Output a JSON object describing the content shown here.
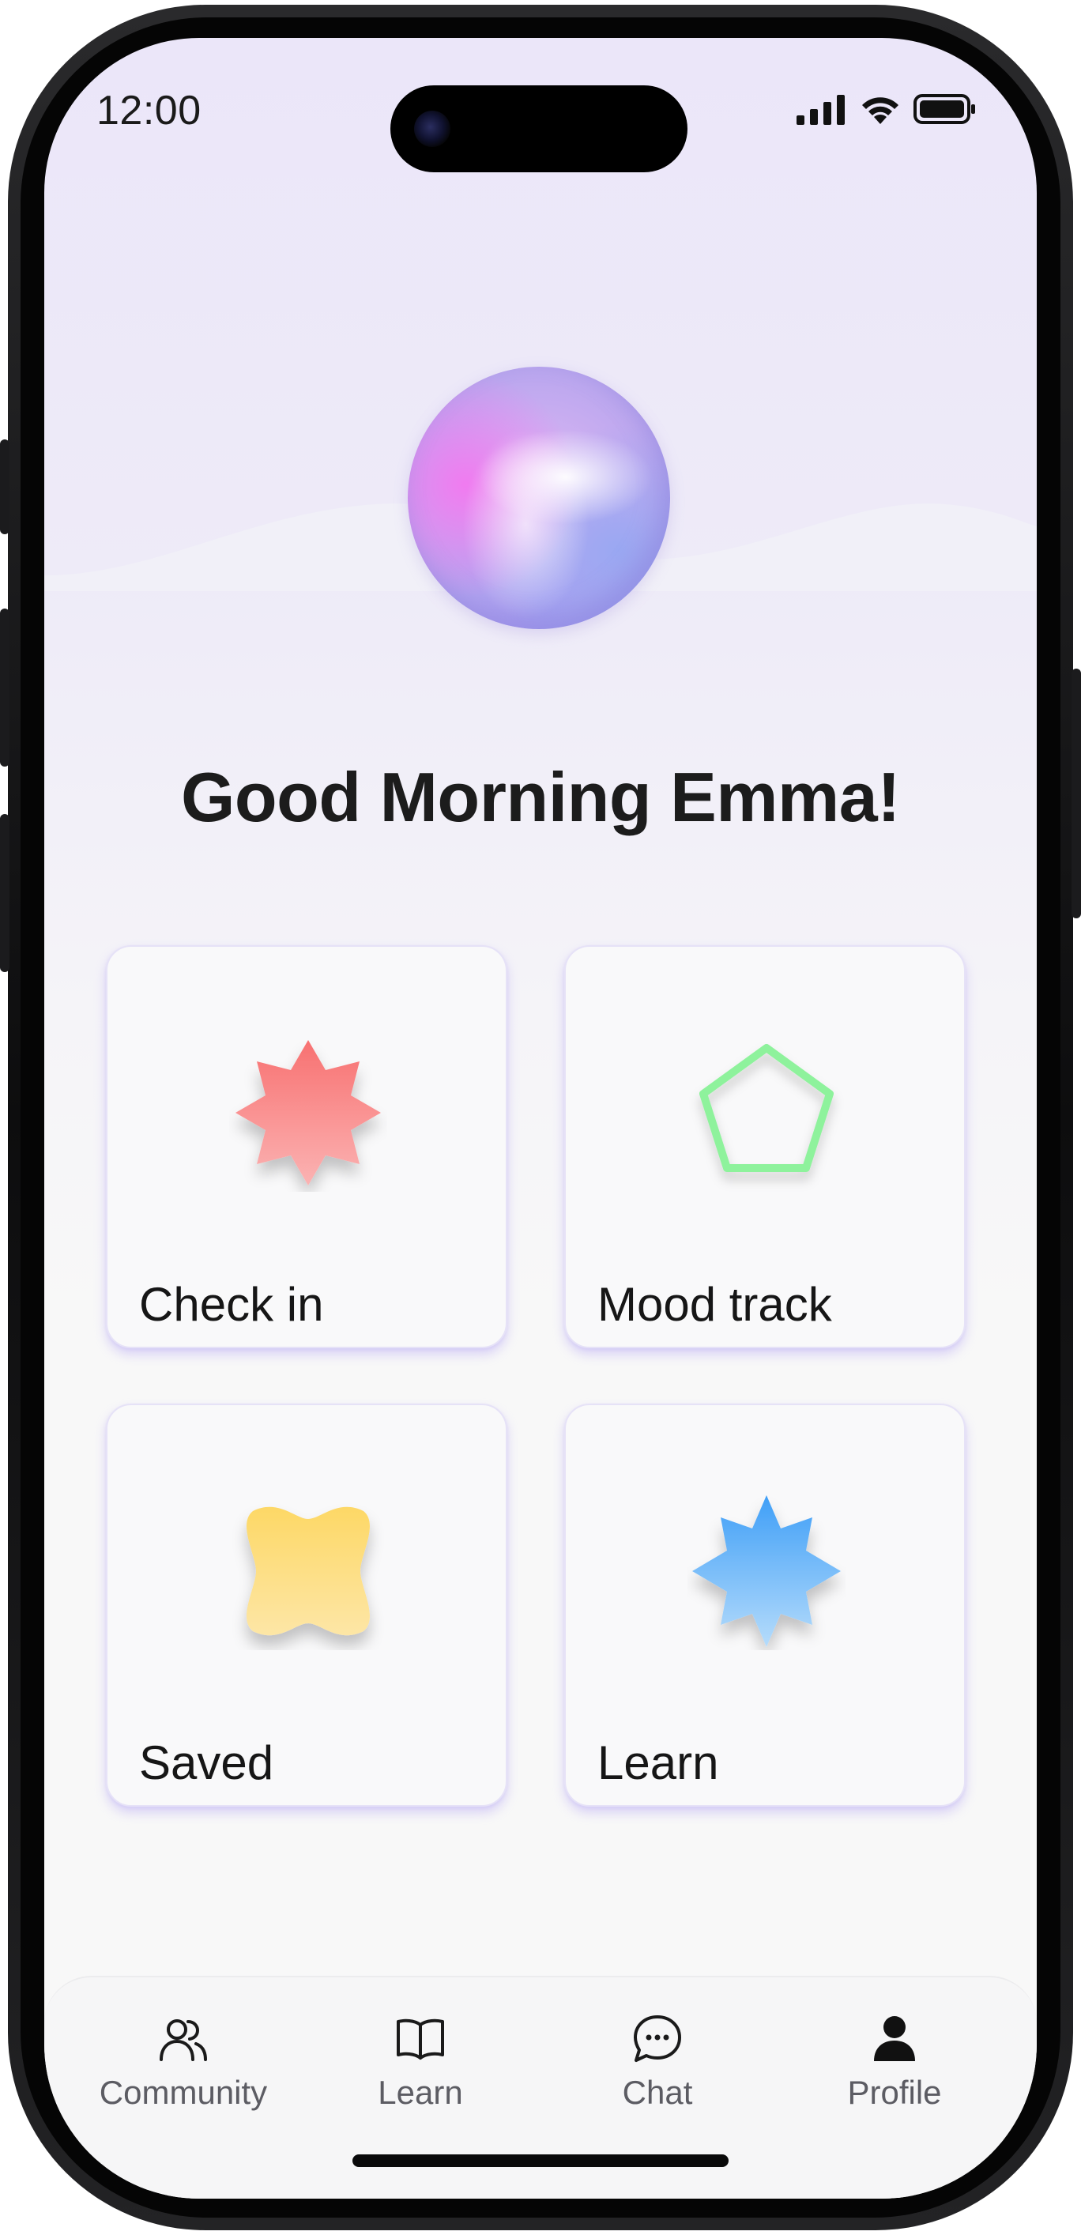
{
  "status_bar": {
    "time": "12:00",
    "icons": [
      "cellular-signal-icon",
      "wifi-icon",
      "battery-icon"
    ]
  },
  "header": {
    "greeting": "Good Morning Emma!"
  },
  "cards": [
    {
      "label": "Check in",
      "icon": "eight-point-star-icon",
      "color": "#f87f7f"
    },
    {
      "label": "Mood track",
      "icon": "pentagon-icon",
      "color": "#8ef29c"
    },
    {
      "label": "Saved",
      "icon": "four-lobe-shape-icon",
      "color": "#fdd866"
    },
    {
      "label": "Learn",
      "icon": "burst-star-icon",
      "color": "#4aa6f8"
    }
  ],
  "bottom_nav": {
    "items": [
      {
        "label": "Community",
        "icon": "people-icon"
      },
      {
        "label": "Learn",
        "icon": "book-icon"
      },
      {
        "label": "Chat",
        "icon": "chat-bubble-icon"
      },
      {
        "label": "Profile",
        "icon": "person-icon"
      }
    ]
  },
  "colors": {
    "background_top": "#ebe6f9",
    "card_border": "#e6e2f7",
    "text": "#1c1c1c",
    "nav_text": "#5c5c63"
  }
}
